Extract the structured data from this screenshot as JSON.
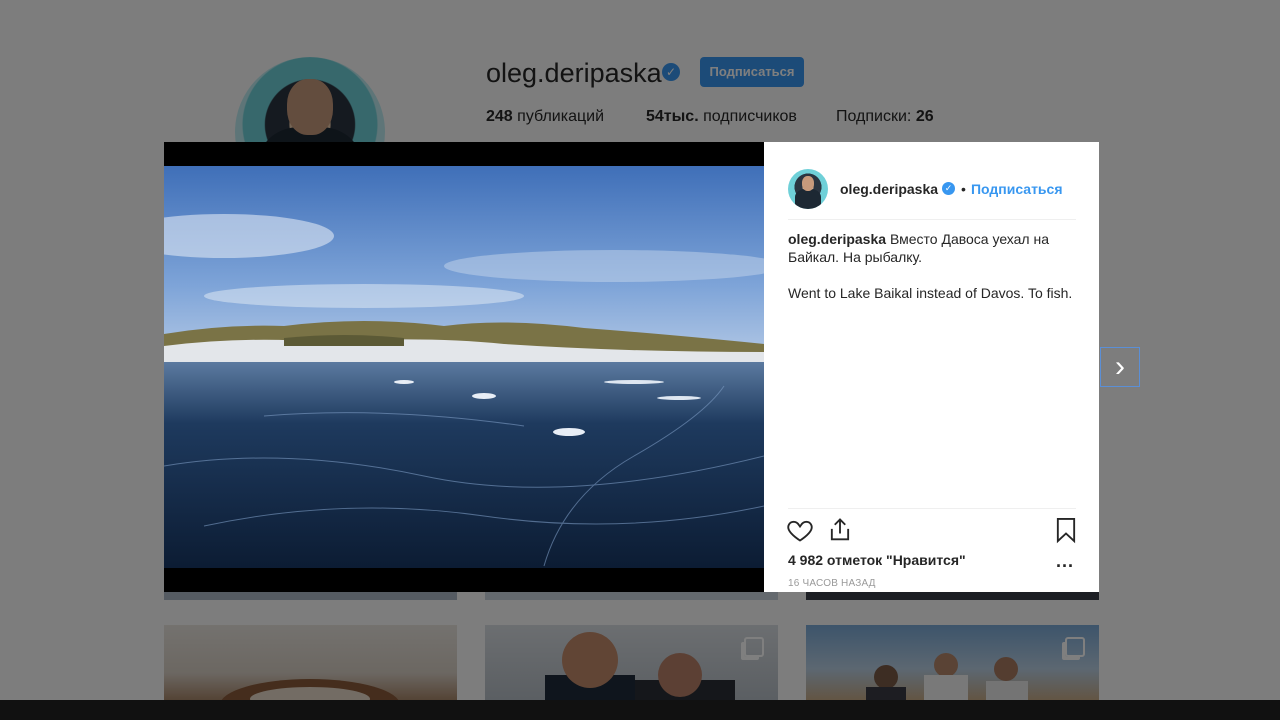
{
  "profile": {
    "username": "oleg.deripaska",
    "follow_label": "Подписаться",
    "posts_count": "248",
    "posts_label": "публикаций",
    "followers_count": "54тыс.",
    "followers_label": "подписчиков",
    "following_label": "Подписки:",
    "following_count": "26"
  },
  "post": {
    "username": "oleg.deripaska",
    "follow_label": "Подписаться",
    "dot": "•",
    "caption_user": "oleg.deripaska",
    "caption_ru": "Вместо Давоса уехал на Байкал. На рыбалку.",
    "caption_en": "Went to Lake Baikal instead of Davos. To fish.",
    "likes": "4 982 отметок \"Нравится\"",
    "time": "16 ЧАСОВ НАЗАД",
    "more": "..."
  },
  "icons": {
    "like": "heart-icon",
    "share": "share-icon",
    "save": "bookmark-icon",
    "next": "chevron-right-icon",
    "verified": "verified-badge-icon"
  },
  "colors": {
    "accent": "#3897f0",
    "text": "#262626",
    "muted": "#999999"
  }
}
